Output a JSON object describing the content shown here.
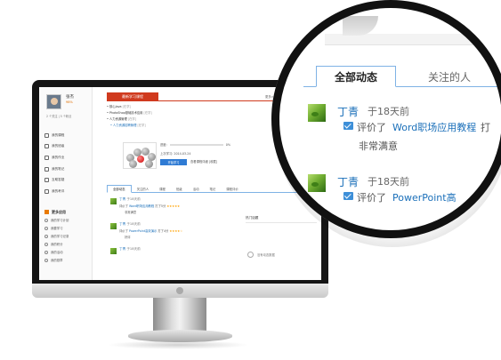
{
  "colors": {
    "accent": "#1a6fb9",
    "brand_red": "#d03a1e",
    "tab_border": "#7fb2e5",
    "stars": "#ffa200",
    "bezel": "#151515"
  },
  "screen": {
    "profile": {
      "name": "张杰",
      "percent": "98%",
      "follow_line": "2 个关注 | 5 个粉丝"
    },
    "nav": [
      {
        "label": "我的课程",
        "icon": "book-icon"
      },
      {
        "label": "我的班级",
        "icon": "class-icon"
      },
      {
        "label": "我的作业",
        "icon": "homework-icon"
      },
      {
        "label": "我的笔记",
        "icon": "note-icon"
      },
      {
        "label": "互助答疑",
        "icon": "qa-icon"
      },
      {
        "label": "我的考评",
        "icon": "exam-icon"
      }
    ],
    "more_apps": {
      "header": "更多应用",
      "items": [
        "我的学习计划",
        "我要学习",
        "我的学习记录",
        "我的积分",
        "我的活动",
        "我的勋章"
      ]
    },
    "banner": "最新学习课程",
    "banner_more": "更多>>",
    "courses": [
      {
        "text": "核心Java",
        "tag": "[在学]",
        "sub": false
      },
      {
        "text": "PhotoShop基础技术应用",
        "tag": "[在学]",
        "sub": false
      },
      {
        "text": "人力资源管理",
        "tag": "[在学]",
        "sub": false
      },
      {
        "text": "人力资源招聘管理",
        "tag": "[在学]",
        "sub": true
      }
    ],
    "progress_label": "进度:",
    "progress_value": "0%",
    "last_study": "上次学习: 2014-03-24",
    "start_button": "开始学习",
    "view_button": "查看课程详细",
    "favorite": "[收藏]",
    "tabs": [
      "全部动态",
      "关注的人",
      "课程",
      "班级",
      "活动",
      "笔记",
      "课程评价"
    ],
    "feed": [
      {
        "name": "丁青",
        "time": "于18天前",
        "action": "评价了",
        "course": "Word职场应用教程",
        "extra": "打了5分",
        "stars": "★★★★★",
        "comment": "非常满意"
      },
      {
        "name": "丁青",
        "time": "于18天前",
        "action": "评价了",
        "course": "PowerPoint高效演示",
        "extra": "打了4分",
        "stars": "★★★★☆",
        "comment": "好评"
      },
      {
        "name": "丁青",
        "time": "于18天前",
        "action": "",
        "course": "",
        "extra": "",
        "stars": "",
        "comment": ""
      }
    ],
    "right_panel": {
      "header": "热门话题",
      "empty": "没有动态数据"
    }
  },
  "lens": {
    "tabs": [
      "全部动态",
      "关注的人",
      "课程"
    ],
    "feed": [
      {
        "name": "丁青",
        "time": "于18天前",
        "action": "评价了",
        "course": "Word职场应用教程",
        "extra": "打",
        "comment": "非常满意"
      },
      {
        "name": "丁青",
        "time": "于18天前",
        "action": "评价了",
        "course": "PowerPoint高",
        "extra": "",
        "comment": ""
      }
    ]
  }
}
